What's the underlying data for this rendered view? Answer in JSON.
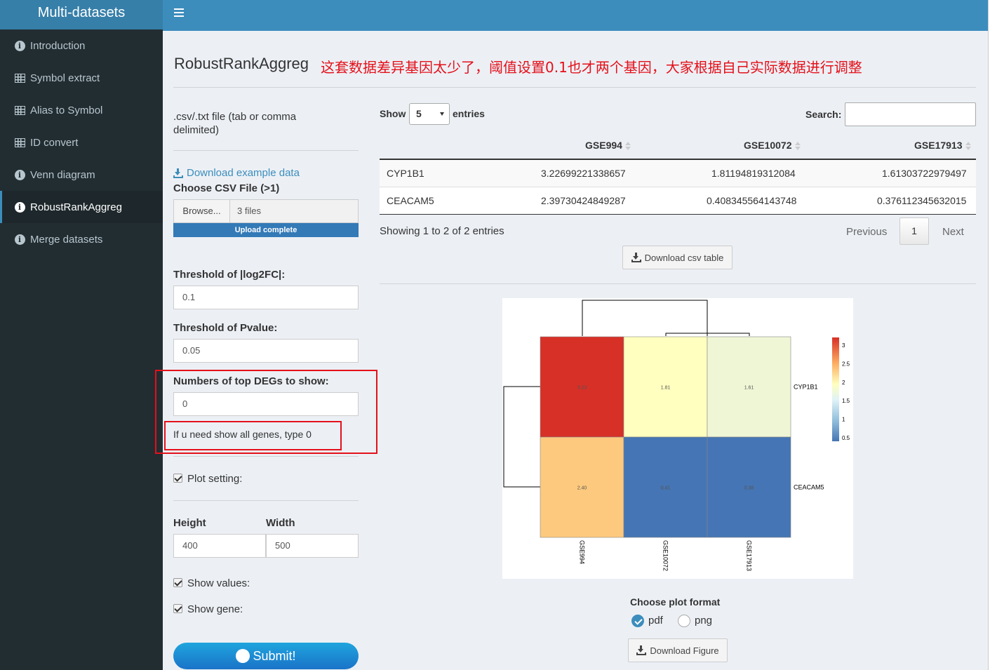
{
  "brand": "Multi-datasets",
  "sidebar": {
    "items": [
      {
        "label": "Introduction",
        "icon": "info-icon"
      },
      {
        "label": "Symbol extract",
        "icon": "table-icon"
      },
      {
        "label": "Alias to Symbol",
        "icon": "table-icon"
      },
      {
        "label": "ID convert",
        "icon": "table-icon"
      },
      {
        "label": "Venn diagram",
        "icon": "info-icon"
      },
      {
        "label": "RobustRankAggreg",
        "icon": "info-icon",
        "active": true
      },
      {
        "label": "Merge datasets",
        "icon": "info-icon"
      }
    ]
  },
  "page": {
    "title": "RobustRankAggreg",
    "note": "这套数据差异基因太少了，阈值设置0.1也才两个基因，大家根据自己实际数据进行调整"
  },
  "form": {
    "file_label_line1": ".csv/.txt file (tab or comma",
    "file_label_line2": "delimited)",
    "download_example": "Download example data",
    "choose_csv": "Choose CSV File (>1)",
    "browse": "Browse...",
    "files_value": "3 files",
    "upload_status": "Upload complete",
    "log2fc_label": "Threshold of |log2FC|:",
    "log2fc_value": "0.1",
    "pvalue_label": "Threshold of Pvalue:",
    "pvalue_value": "0.05",
    "topdeg_label": "Numbers of top DEGs to show:",
    "topdeg_value": "0",
    "topdeg_hint": "If u need show all genes, type 0",
    "plot_setting": "Plot setting:",
    "height_label": "Height",
    "width_label": "Width",
    "height_value": "400",
    "width_value": "500",
    "show_values": "Show values:",
    "show_gene": "Show gene:",
    "submit": "Submit!"
  },
  "table": {
    "show_label": "Show",
    "entries_label": "entries",
    "page_size": "5",
    "search_label": "Search:",
    "columns": [
      "",
      "GSE994",
      "GSE10072",
      "GSE17913"
    ],
    "rows": [
      [
        "CYP1B1",
        "3.22699221338657",
        "1.81194819312084",
        "1.61303722979497"
      ],
      [
        "CEACAM5",
        "2.39730424849287",
        "0.408345564143748",
        "0.376112345632015"
      ]
    ],
    "info": "Showing 1 to 2 of 2 entries",
    "previous": "Previous",
    "page": "1",
    "next": "Next",
    "download_csv": "Download csv table"
  },
  "heatmap": {
    "genes": [
      "CYP1B1",
      "CEACAM5"
    ],
    "samples": [
      "GSE994",
      "GSE10072",
      "GSE17913"
    ],
    "values": [
      [
        3.23,
        1.81,
        1.61
      ],
      [
        2.4,
        0.41,
        0.38
      ]
    ],
    "cell_labels": [
      [
        "3.23",
        "1.81",
        "1.61"
      ],
      [
        "2.40",
        "0.41",
        "0.38"
      ]
    ],
    "legend_ticks": [
      "3",
      "2.5",
      "2",
      "1.5",
      "1",
      "0.5"
    ],
    "colors": {
      "high": "#d73027",
      "mid": "#ffffbf",
      "low": "#4575b4",
      "orange": "#fdc97e",
      "lightgreen": "#eef6d6"
    }
  },
  "plot_format": {
    "label": "Choose plot format",
    "options": [
      "pdf",
      "png"
    ],
    "selected": "pdf",
    "download": "Download Figure"
  }
}
